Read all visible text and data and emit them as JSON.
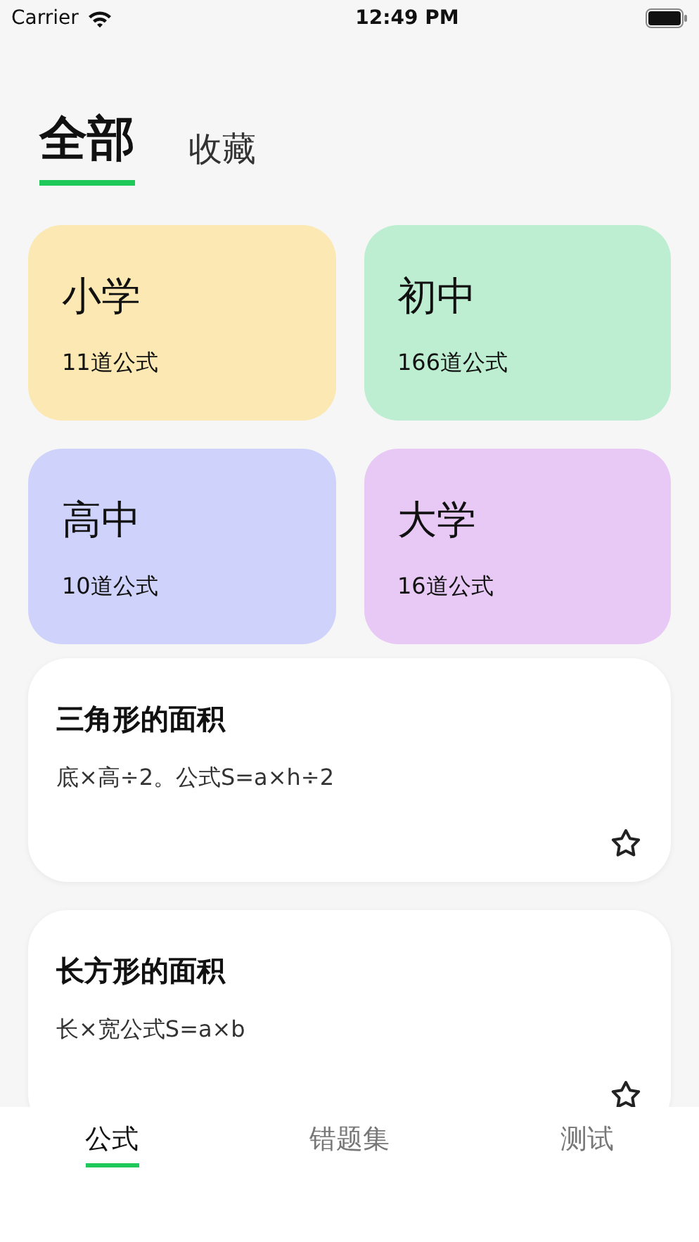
{
  "status_bar": {
    "carrier": "Carrier",
    "time": "12:49 PM"
  },
  "top_tabs": [
    {
      "label": "全部",
      "selected": true
    },
    {
      "label": "收藏",
      "selected": false
    }
  ],
  "categories": [
    {
      "name": "小学",
      "count": "11道公式",
      "color": "#fce8b2"
    },
    {
      "name": "初中",
      "count": "166道公式",
      "color": "#bdeed1"
    },
    {
      "name": "高中",
      "count": "10道公式",
      "color": "#cfd3fb"
    },
    {
      "name": "大学",
      "count": "16道公式",
      "color": "#e8c9f5"
    }
  ],
  "formulas": [
    {
      "title": "三角形的面积",
      "text": "底×高÷2。公式S=a×h÷2",
      "favorited": false
    },
    {
      "title": "长方形的面积",
      "text": "长×宽公式S=a×b",
      "favorited": false
    }
  ],
  "bottom_nav": [
    {
      "label": "公式",
      "selected": true
    },
    {
      "label": "错题集",
      "selected": false
    },
    {
      "label": "测试",
      "selected": false
    }
  ]
}
